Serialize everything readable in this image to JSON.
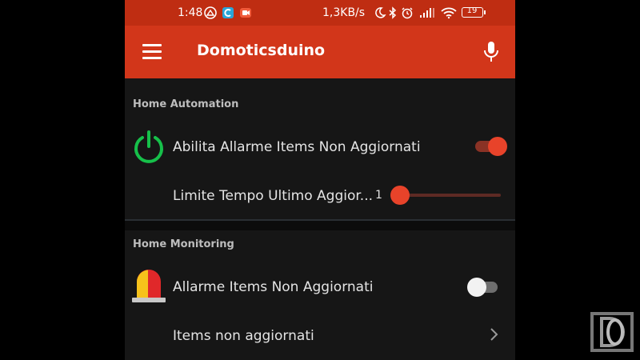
{
  "status_bar": {
    "time": "1:48",
    "network_speed": "1,3KB/s",
    "battery": "19"
  },
  "app_bar": {
    "title": "Domoticsduino"
  },
  "sections": [
    {
      "title": "Home Automation",
      "items": [
        {
          "label": "Abilita Allarme Items Non Aggiornati",
          "icon": "power-icon",
          "toggle": true
        },
        {
          "label": "Limite Tempo Ultimo Aggior...",
          "slider_value": "1",
          "slider_fraction": 0
        }
      ]
    },
    {
      "title": "Home Monitoring",
      "items": [
        {
          "label": "Allarme Items Non Aggiornati",
          "icon": "siren-icon",
          "toggle": false
        },
        {
          "label": "Items non aggiornati",
          "icon": "chevron-right-icon"
        }
      ]
    }
  ],
  "colors": {
    "accent": "#d2361a",
    "statusbar": "#bf2d12",
    "power_icon": "#16c04a",
    "toggle_on": "#e8432a"
  }
}
